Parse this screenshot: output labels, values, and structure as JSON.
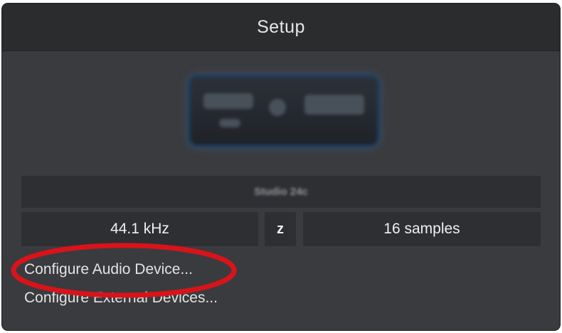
{
  "header": {
    "title": "Setup"
  },
  "device": {
    "name": "Studio 24c"
  },
  "settings": {
    "sample_rate": "44.1 kHz",
    "link_symbol": "z",
    "buffer_size": "16 samples"
  },
  "links": {
    "configure_audio": "Configure Audio Device...",
    "configure_external": "Configure External Devices..."
  },
  "colors": {
    "panel": "#3a3b3e",
    "header": "#2b2c2e",
    "field": "#2e2f32",
    "annotation": "#d8141a"
  }
}
